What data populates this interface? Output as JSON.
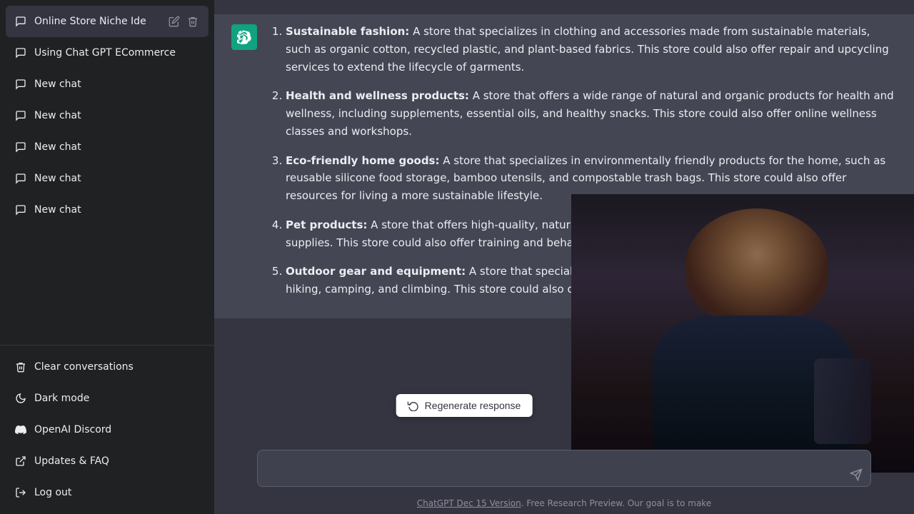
{
  "sidebar": {
    "items_top": [
      {
        "id": "online-store",
        "label": "Online Store Niche Ide",
        "icon": "chat-icon",
        "active": true,
        "has_actions": true
      },
      {
        "id": "using-chat-gpt",
        "label": "Using Chat GPT ECommerce",
        "icon": "chat-icon",
        "active": false,
        "has_actions": false
      },
      {
        "id": "new-chat-1",
        "label": "New chat",
        "icon": "chat-icon",
        "active": false
      },
      {
        "id": "new-chat-2",
        "label": "New chat",
        "icon": "chat-icon",
        "active": false
      },
      {
        "id": "new-chat-3",
        "label": "New chat",
        "icon": "chat-icon",
        "active": false
      },
      {
        "id": "new-chat-4",
        "label": "New chat",
        "icon": "chat-icon",
        "active": false
      },
      {
        "id": "new-chat-5",
        "label": "New chat",
        "icon": "chat-icon",
        "active": false
      }
    ],
    "items_bottom": [
      {
        "id": "clear-conversations",
        "label": "Clear conversations",
        "icon": "trash-icon"
      },
      {
        "id": "dark-mode",
        "label": "Dark mode",
        "icon": "moon-icon"
      },
      {
        "id": "openai-discord",
        "label": "OpenAI Discord",
        "icon": "discord-icon"
      },
      {
        "id": "updates-faq",
        "label": "Updates & FAQ",
        "icon": "external-icon"
      },
      {
        "id": "log-out",
        "label": "Log out",
        "icon": "logout-icon"
      }
    ]
  },
  "chat": {
    "response_items": [
      {
        "number": 1,
        "title": "Sustainable fashion",
        "text": "A store that specializes in clothing and accessories made from sustainable materials, such as organic cotton, recycled plastic, and plant-based fabrics. This store could also offer repair and upcycling services to extend the lifecycle of garments."
      },
      {
        "number": 2,
        "title": "Health and wellness products",
        "text": "A store that offers a wide range of natural and organic products for health and wellness, including supplements, essential oils, and healthy snacks. This store could also offer online wellness classes and workshops."
      },
      {
        "number": 3,
        "title": "Eco-friendly home goods",
        "text": "A store that specializes in environmentally friendly products for the home, such as reusable silicone food storage, bamboo utensils, and compostable trash bags. This store could also offer resources for living a more sustainable lifestyle."
      },
      {
        "number": 4,
        "title": "Pet products",
        "text": "A store that offers high-quality, natural products for pets, including food, toys, and grooming supplies. This store could also offer training and behavior modification courses for pet owners."
      },
      {
        "number": 5,
        "title": "Outdoor gear and equipment",
        "text": "A store that specializes in outdoor gear and equipment for activities such as hiking, camping, and climbing. This store could also offer online courses and workshops."
      }
    ],
    "input_placeholder": "",
    "regenerate_label": "Regenerate response",
    "footer_text": ". Free Research Preview. Our goal is to make",
    "footer_link": "ChatGPT Dec 15 Version",
    "footer_link_href": "#"
  }
}
